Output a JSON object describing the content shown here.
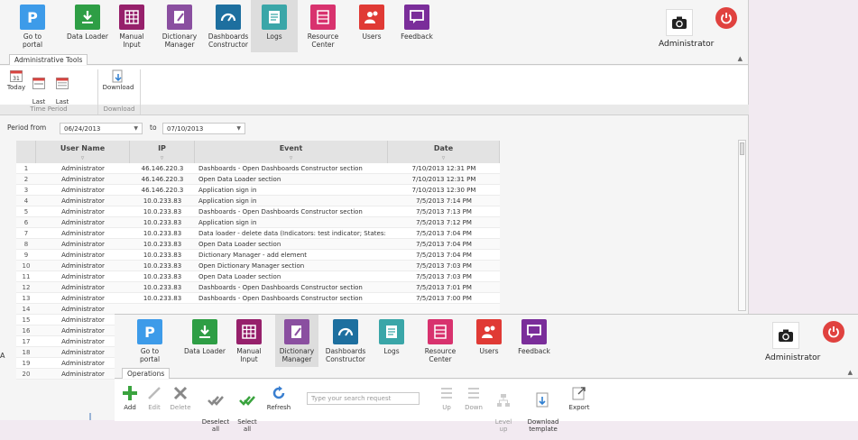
{
  "nav": [
    {
      "label": "Go to portal",
      "icon": "portal-icon",
      "color": "#3d9be9"
    },
    {
      "label": "Data Loader",
      "icon": "download-icon",
      "color": "#2e9e45"
    },
    {
      "label": "Manual\nInput",
      "icon": "grid-icon",
      "color": "#96206b"
    },
    {
      "label": "Dictionary\nManager",
      "icon": "dictionary-icon",
      "color": "#8a4fa0"
    },
    {
      "label": "Dashboards\nConstructor",
      "icon": "gauge-icon",
      "color": "#1d6f9f"
    },
    {
      "label": "Logs",
      "icon": "logs-icon",
      "color": "#3aa6a8"
    },
    {
      "label": "Resource\nCenter",
      "icon": "resource-icon",
      "color": "#d8326e"
    },
    {
      "label": "Users",
      "icon": "users-icon",
      "color": "#e03a35"
    },
    {
      "label": "Feedback",
      "icon": "feedback-icon",
      "color": "#7a2d9a"
    }
  ],
  "user": {
    "name": "Administrator"
  },
  "win1": {
    "active_nav": "Logs",
    "tab": "Administrative Tools",
    "ribbon": {
      "today": "Today",
      "last_week": "Last\nWeek",
      "last_month": "Last\nMonth",
      "download": "Download",
      "group_time": "Time Period",
      "group_download": "Download"
    },
    "filter": {
      "period_label": "Period from",
      "from": "06/24/2013",
      "to_label": "to",
      "to": "07/10/2013"
    },
    "columns": [
      "User Name",
      "IP",
      "Event",
      "Date"
    ],
    "rows": [
      [
        "1",
        "Administrator",
        "46.146.220.3",
        "Dashboards - Open Dashboards Constructor section",
        "7/10/2013 12:31 PM"
      ],
      [
        "2",
        "Administrator",
        "46.146.220.3",
        "Open Data Loader section",
        "7/10/2013 12:31 PM"
      ],
      [
        "3",
        "Administrator",
        "46.146.220.3",
        "Application sign in",
        "7/10/2013 12:30 PM"
      ],
      [
        "4",
        "Administrator",
        "10.0.233.83",
        "Application sign in",
        "7/5/2013 7:14 PM"
      ],
      [
        "5",
        "Administrator",
        "10.0.233.83",
        "Dashboards - Open Dashboards Constructor section",
        "7/5/2013 7:13 PM"
      ],
      [
        "6",
        "Administrator",
        "10.0.233.83",
        "Application sign in",
        "7/5/2013 7:12 PM"
      ],
      [
        "7",
        "Administrator",
        "10.0.233.83",
        "Data loader - delete data (Indicators: test indicator; States: Nigeria, A...",
        "7/5/2013 7:04 PM"
      ],
      [
        "8",
        "Administrator",
        "10.0.233.83",
        "Open Data Loader section",
        "7/5/2013 7:04 PM"
      ],
      [
        "9",
        "Administrator",
        "10.0.233.83",
        "Dictionary Manager - add element",
        "7/5/2013 7:04 PM"
      ],
      [
        "10",
        "Administrator",
        "10.0.233.83",
        "Open Dictionary Manager section",
        "7/5/2013 7:03 PM"
      ],
      [
        "11",
        "Administrator",
        "10.0.233.83",
        "Open Data Loader section",
        "7/5/2013 7:03 PM"
      ],
      [
        "12",
        "Administrator",
        "10.0.233.83",
        "Dashboards - Open Dashboards Constructor section",
        "7/5/2013 7:01 PM"
      ],
      [
        "13",
        "Administrator",
        "10.0.233.83",
        "Dashboards - Open Dashboards Constructor section",
        "7/5/2013 7:00 PM"
      ],
      [
        "14",
        "Administrator",
        "",
        "",
        ""
      ],
      [
        "15",
        "Administrator",
        "",
        "",
        ""
      ],
      [
        "16",
        "Administrator",
        "",
        "",
        ""
      ],
      [
        "17",
        "Administrator",
        "",
        "",
        ""
      ],
      [
        "18",
        "Administrator",
        "",
        "",
        ""
      ],
      [
        "19",
        "Administrator",
        "",
        "",
        ""
      ],
      [
        "20",
        "Administrator",
        "",
        "",
        ""
      ]
    ]
  },
  "win2": {
    "active_nav": "Dictionary\nManager",
    "tab": "Operations",
    "tools": {
      "add": "Add",
      "edit": "Edit",
      "delete": "Delete",
      "deselect_all": "Deselect\nall",
      "select_all": "Select\nall",
      "refresh": "Refresh",
      "up": "Up",
      "down": "Down",
      "level_up": "Level\nup",
      "download_template": "Download\ntemplate",
      "export": "Export"
    },
    "search_placeholder": "Type your search request"
  },
  "peek_text": "A"
}
